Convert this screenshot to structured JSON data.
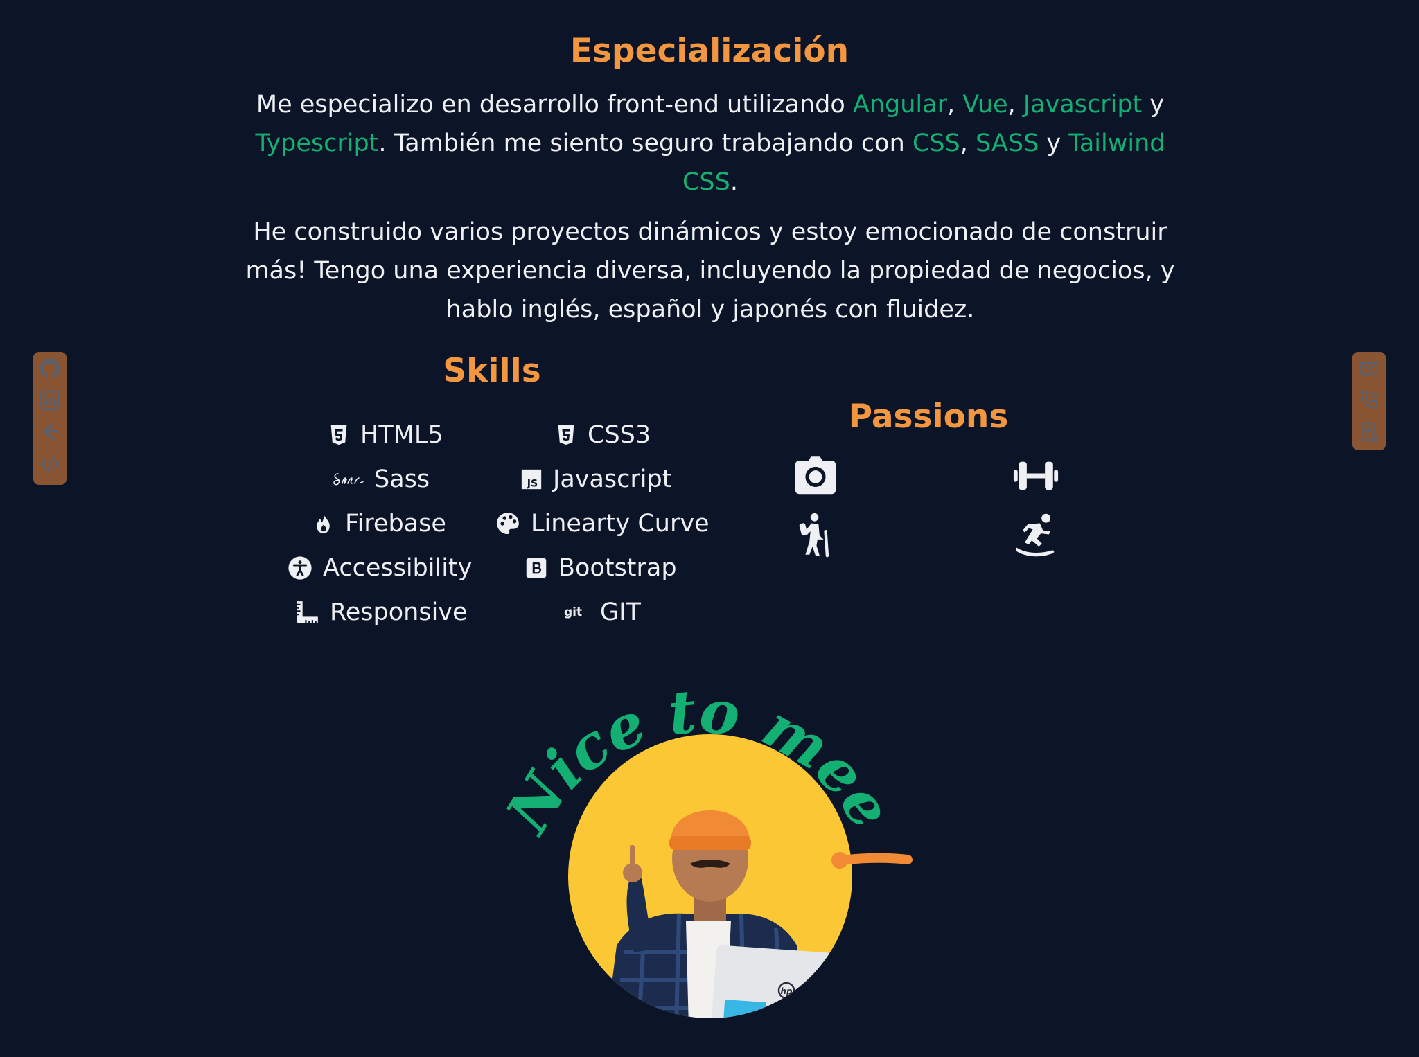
{
  "specialization": {
    "title": "Especialización",
    "p1": [
      {
        "t": "Me especializo en desarrollo front-end utilizando ",
        "hl": false
      },
      {
        "t": "Angular",
        "hl": true
      },
      {
        "t": ", ",
        "hl": false
      },
      {
        "t": "Vue",
        "hl": true
      },
      {
        "t": ", ",
        "hl": false
      },
      {
        "t": "Javascript",
        "hl": true
      },
      {
        "t": " y ",
        "hl": false
      },
      {
        "t": "Typescript",
        "hl": true
      },
      {
        "t": ". También me siento seguro trabajando con ",
        "hl": false
      },
      {
        "t": "CSS",
        "hl": true
      },
      {
        "t": ", ",
        "hl": false
      },
      {
        "t": "SASS",
        "hl": true
      },
      {
        "t": " y ",
        "hl": false
      },
      {
        "t": "Tailwind CSS",
        "hl": true
      },
      {
        "t": ".",
        "hl": false
      }
    ],
    "p2": "He construido varios proyectos dinámicos y estoy emocionado de construir más! Tengo una experiencia diversa, incluyendo la propiedad de negocios, y hablo inglés, español y japonés con fluidez."
  },
  "skills": {
    "title": "Skills",
    "items": [
      {
        "label": "HTML5",
        "icon": "html5-icon"
      },
      {
        "label": "CSS3",
        "icon": "css3-icon"
      },
      {
        "label": "Sass",
        "icon": "sass-icon"
      },
      {
        "label": "Javascript",
        "icon": "javascript-icon"
      },
      {
        "label": "Firebase",
        "icon": "firebase-flame-icon"
      },
      {
        "label": "Linearty Curve",
        "icon": "palette-icon"
      },
      {
        "label": "Accessibility",
        "icon": "accessibility-icon"
      },
      {
        "label": "Bootstrap",
        "icon": "bootstrap-icon"
      },
      {
        "label": "Responsive",
        "icon": "ruler-icon"
      },
      {
        "label": "GIT",
        "icon": "git-icon"
      }
    ]
  },
  "passions": {
    "title": "Passions",
    "items": [
      "camera-icon",
      "dumbbell-icon",
      "hiking-icon",
      "snowboarding-icon"
    ]
  },
  "social_left": [
    "github-icon",
    "linkedin-icon",
    "codewars-icon",
    "code-icon"
  ],
  "social_right": [
    "email-icon",
    "phone-icon",
    "resume-icon"
  ],
  "hero": {
    "caption": "Nice to meet you!",
    "laptop_brand": "hp"
  },
  "colors": {
    "background": "#0c1427",
    "heading": "#f2963f",
    "highlight": "#14b073",
    "sun": "#fcc735",
    "rail": "#8a5532"
  }
}
